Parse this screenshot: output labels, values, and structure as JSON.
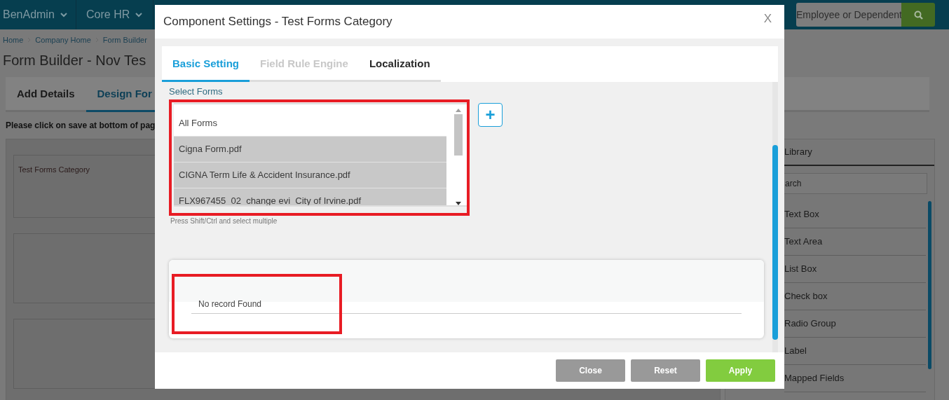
{
  "nav": {
    "menus": [
      {
        "label": "BenAdmin"
      },
      {
        "label": "Core HR"
      }
    ],
    "search": {
      "placeholder": "Employee or Dependent"
    }
  },
  "breadcrumb": [
    "Home",
    "Company Home",
    "Form Builder"
  ],
  "page_title": "Form Builder - Nov Tes",
  "page_tabs": [
    {
      "label": "Add Details",
      "selected": false
    },
    {
      "label": "Design For",
      "selected": true
    }
  ],
  "notice": "Please click on save at bottom of pag",
  "canvas": {
    "section_title": "Test Forms Category"
  },
  "library": {
    "title": "Library",
    "search_value": "arch",
    "items": [
      "Text Box",
      "Text Area",
      "List Box",
      "Check box",
      "Radio Group",
      "Label",
      "Mapped Fields"
    ]
  },
  "dialog": {
    "title": "Component Settings - Test Forms Category",
    "close": "X",
    "tabs": [
      {
        "label": "Basic Setting",
        "selected": true,
        "disabled": false
      },
      {
        "label": "Field Rule Engine",
        "selected": false,
        "disabled": true
      },
      {
        "label": "Localization",
        "selected": false,
        "disabled": false
      }
    ],
    "select_label": "Select Forms",
    "forms": [
      {
        "name": "All Forms",
        "selected": false
      },
      {
        "name": "Cigna Form.pdf",
        "selected": true
      },
      {
        "name": "CIGNA Term Life & Accident Insurance.pdf",
        "selected": true
      },
      {
        "name": "FLX967455_02_change evi_City of Irvine.pdf",
        "selected": true
      }
    ],
    "add_button": "+",
    "hint": "Press Shift/Ctrl and select multiple",
    "empty_message": "No record Found",
    "buttons": [
      {
        "label": "Close",
        "kind": "secondary"
      },
      {
        "label": "Reset",
        "kind": "secondary"
      },
      {
        "label": "Apply",
        "kind": "primary"
      }
    ]
  }
}
